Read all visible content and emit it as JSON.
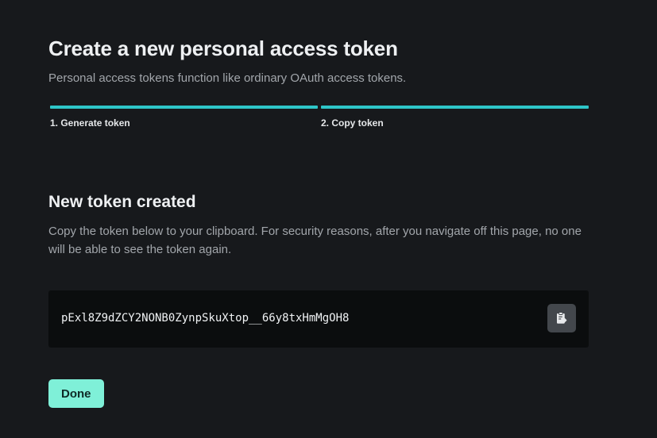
{
  "header": {
    "title": "Create a new personal access token",
    "subtitle": "Personal access tokens function like ordinary OAuth access tokens."
  },
  "stepper": {
    "steps": [
      {
        "label": "1. Generate token"
      },
      {
        "label": "2. Copy token"
      }
    ],
    "accent_color": "#2ec6c8"
  },
  "token_section": {
    "title": "New token created",
    "description": "Copy the token below to your clipboard. For security reasons, after you navigate off this page, no one will be able to see the token again.",
    "token_value": "pExl8Z9dZCY2NONB0ZynpSkuXtop__66y8txHmMgOH8",
    "copy_icon": "clipboard-copy-icon"
  },
  "actions": {
    "done_label": "Done",
    "done_color": "#7ff0d8"
  }
}
